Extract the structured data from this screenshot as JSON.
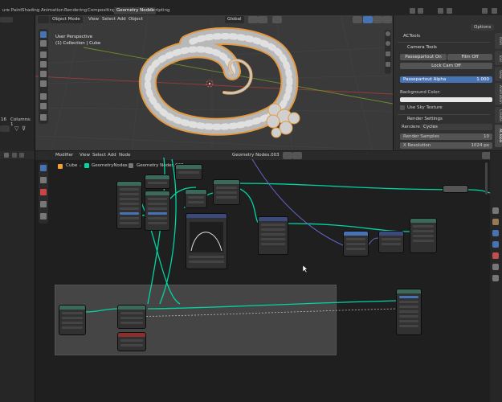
{
  "workspace": {
    "tabs": [
      {
        "label": "ure Paint"
      },
      {
        "label": "Shading"
      },
      {
        "label": "Animation"
      },
      {
        "label": "Rendering"
      },
      {
        "label": "Compositing"
      },
      {
        "label": "Geometry Nodes"
      },
      {
        "label": "Scripting"
      }
    ]
  },
  "left_panel": {
    "number": "16",
    "columns": "Columns: 1"
  },
  "viewport": {
    "mode": "Object Mode",
    "menus": [
      "View",
      "Select",
      "Add",
      "Object"
    ],
    "transform": "Global",
    "options": "Options",
    "overlay_title": "User Perspective",
    "overlay_subtitle": "(1) Collection | Cube"
  },
  "npanel": {
    "title": "ACTools",
    "camera_tools": "Camera Tools",
    "passepartout_on": "Passepartout On",
    "film_off": "Film Off",
    "lock_cam_off": "Lock Cam Off",
    "passepartout_alpha_label": "Passepartout Alpha",
    "passepartout_alpha_value": "1.000",
    "background_color": "Background Color:",
    "use_sky_texture": "Use Sky Texture",
    "render_settings": "Render Settings",
    "renderer_label": "Renderer:",
    "renderer_value": "Cycles",
    "render_samples_label": "Render Samples",
    "render_samples_value": "10",
    "x_resolution_label": "X Resolution",
    "x_resolution_value": "1024 px",
    "vtabs": [
      "Item",
      "Tool",
      "View",
      "Animation",
      "Create",
      "ACTools"
    ]
  },
  "node_editor": {
    "menus": [
      "Modifier",
      "View",
      "Select",
      "Add",
      "Node"
    ],
    "tree_name": "Geometry Nodes.003",
    "breadcrumb": [
      "Cube",
      "GeometryNodes",
      "Geometry Nodes.003"
    ]
  },
  "colors": {
    "accent": "#4772b3",
    "geometry_link": "#00d6a3",
    "selection": "#f6a033"
  }
}
